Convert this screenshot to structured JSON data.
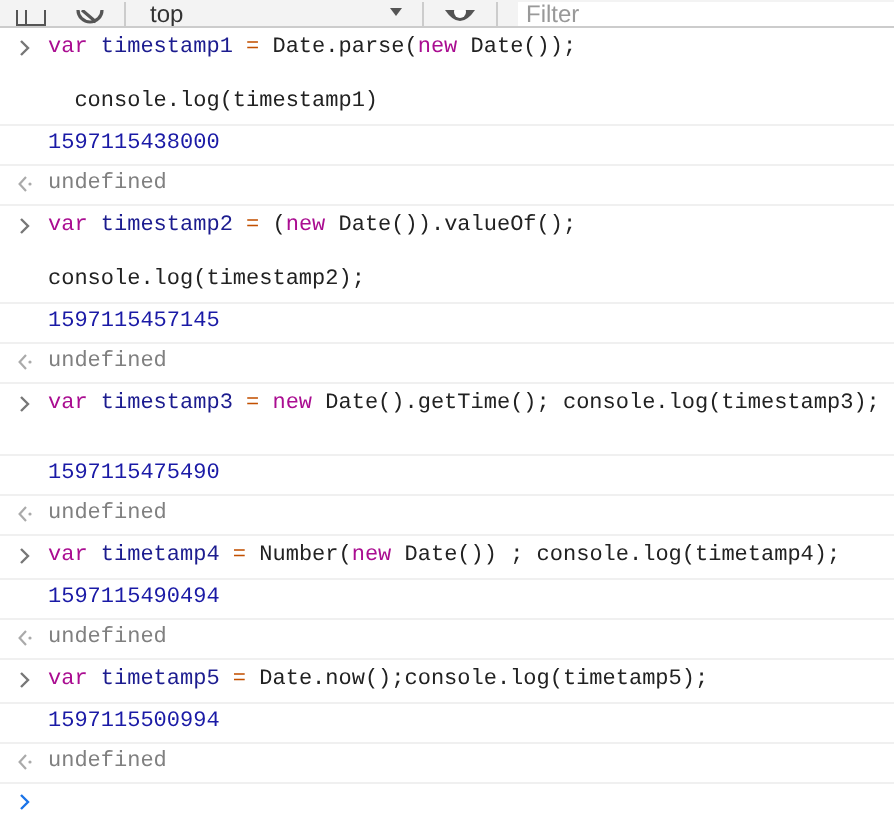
{
  "toolbar": {
    "context": "top",
    "filter": {
      "placeholder": "Filter"
    }
  },
  "entries": [
    {
      "kind": "input",
      "lines": [
        {
          "blank_after": true,
          "tokens": [
            {
              "kind": "keyword",
              "text": "var "
            },
            {
              "kind": "variable",
              "text": "timestamp1"
            },
            {
              "kind": "operator",
              "text": " = "
            },
            {
              "kind": "plain",
              "text": "Date.parse("
            },
            {
              "kind": "keyword",
              "text": "new"
            },
            {
              "kind": "plain",
              "text": " Date());"
            }
          ]
        },
        {
          "blank_after": false,
          "tokens": [
            {
              "kind": "plain",
              "text": "  console.log(timestamp1)"
            }
          ]
        }
      ]
    },
    {
      "kind": "output",
      "text": "1597115438000"
    },
    {
      "kind": "result",
      "text": "undefined"
    },
    {
      "kind": "input",
      "lines": [
        {
          "blank_after": true,
          "tokens": [
            {
              "kind": "keyword",
              "text": "var "
            },
            {
              "kind": "variable",
              "text": "timestamp2"
            },
            {
              "kind": "operator",
              "text": " = "
            },
            {
              "kind": "plain",
              "text": "("
            },
            {
              "kind": "keyword",
              "text": "new"
            },
            {
              "kind": "plain",
              "text": " Date()).valueOf();"
            }
          ]
        },
        {
          "blank_after": false,
          "tokens": [
            {
              "kind": "plain",
              "text": "console.log(timestamp2);"
            }
          ]
        }
      ]
    },
    {
      "kind": "output",
      "text": "1597115457145"
    },
    {
      "kind": "result",
      "text": "undefined"
    },
    {
      "kind": "input",
      "lines": [
        {
          "blank_after": true,
          "tokens": [
            {
              "kind": "keyword",
              "text": "var "
            },
            {
              "kind": "variable",
              "text": "timestamp3"
            },
            {
              "kind": "operator",
              "text": " = "
            },
            {
              "kind": "keyword",
              "text": "new"
            },
            {
              "kind": "plain",
              "text": " Date().getTime(); console.log(timestamp3);"
            }
          ]
        }
      ]
    },
    {
      "kind": "output",
      "text": "1597115475490"
    },
    {
      "kind": "result",
      "text": "undefined"
    },
    {
      "kind": "input",
      "lines": [
        {
          "blank_after": false,
          "tokens": [
            {
              "kind": "keyword",
              "text": "var "
            },
            {
              "kind": "variable",
              "text": "timetamp4"
            },
            {
              "kind": "operator",
              "text": " = "
            },
            {
              "kind": "plain",
              "text": "Number("
            },
            {
              "kind": "keyword",
              "text": "new"
            },
            {
              "kind": "plain",
              "text": " Date()) ; console.log(timetamp4);"
            }
          ]
        }
      ]
    },
    {
      "kind": "output",
      "text": "1597115490494"
    },
    {
      "kind": "result",
      "text": "undefined"
    },
    {
      "kind": "input",
      "lines": [
        {
          "blank_after": false,
          "tokens": [
            {
              "kind": "keyword",
              "text": "var "
            },
            {
              "kind": "variable",
              "text": "timetamp5"
            },
            {
              "kind": "operator",
              "text": " = "
            },
            {
              "kind": "plain",
              "text": "Date.now();console.log(timetamp5);"
            }
          ]
        }
      ]
    },
    {
      "kind": "output",
      "text": "1597115500994"
    },
    {
      "kind": "result",
      "text": "undefined"
    }
  ]
}
